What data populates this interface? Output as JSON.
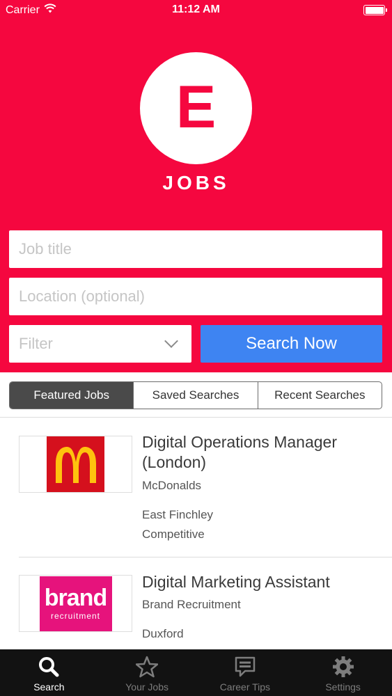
{
  "status_bar": {
    "carrier": "Carrier",
    "time": "11:12 AM",
    "battery_level": 1.0
  },
  "brand": {
    "logo_letter": "E",
    "logo_text": "JOBS",
    "brand_color": "#f5073f"
  },
  "search": {
    "job_title_placeholder": "Job title",
    "location_placeholder": "Location (optional)",
    "filter_placeholder": "Filter",
    "search_button": "Search Now",
    "button_color": "#3e84f2"
  },
  "segments": [
    {
      "label": "Featured Jobs",
      "active": true
    },
    {
      "label": "Saved Searches",
      "active": false
    },
    {
      "label": "Recent Searches",
      "active": false
    }
  ],
  "jobs": [
    {
      "title": "Digital Operations Manager (London)",
      "company": "McDonalds",
      "location": "East Finchley",
      "salary": "Competitive",
      "logo": "mcdonalds-logo"
    },
    {
      "title": "Digital Marketing Assistant",
      "company": "Brand Recruitment",
      "location": "Duxford",
      "salary": "",
      "logo_text": "brand",
      "logo_subtext": "recruitment"
    }
  ],
  "tabbar": [
    {
      "label": "Search",
      "icon": "search-icon",
      "active": true
    },
    {
      "label": "Your Jobs",
      "icon": "star-icon",
      "active": false
    },
    {
      "label": "Career Tips",
      "icon": "chat-bubble-icon",
      "active": false
    },
    {
      "label": "Settings",
      "icon": "gear-icon",
      "active": false
    }
  ]
}
